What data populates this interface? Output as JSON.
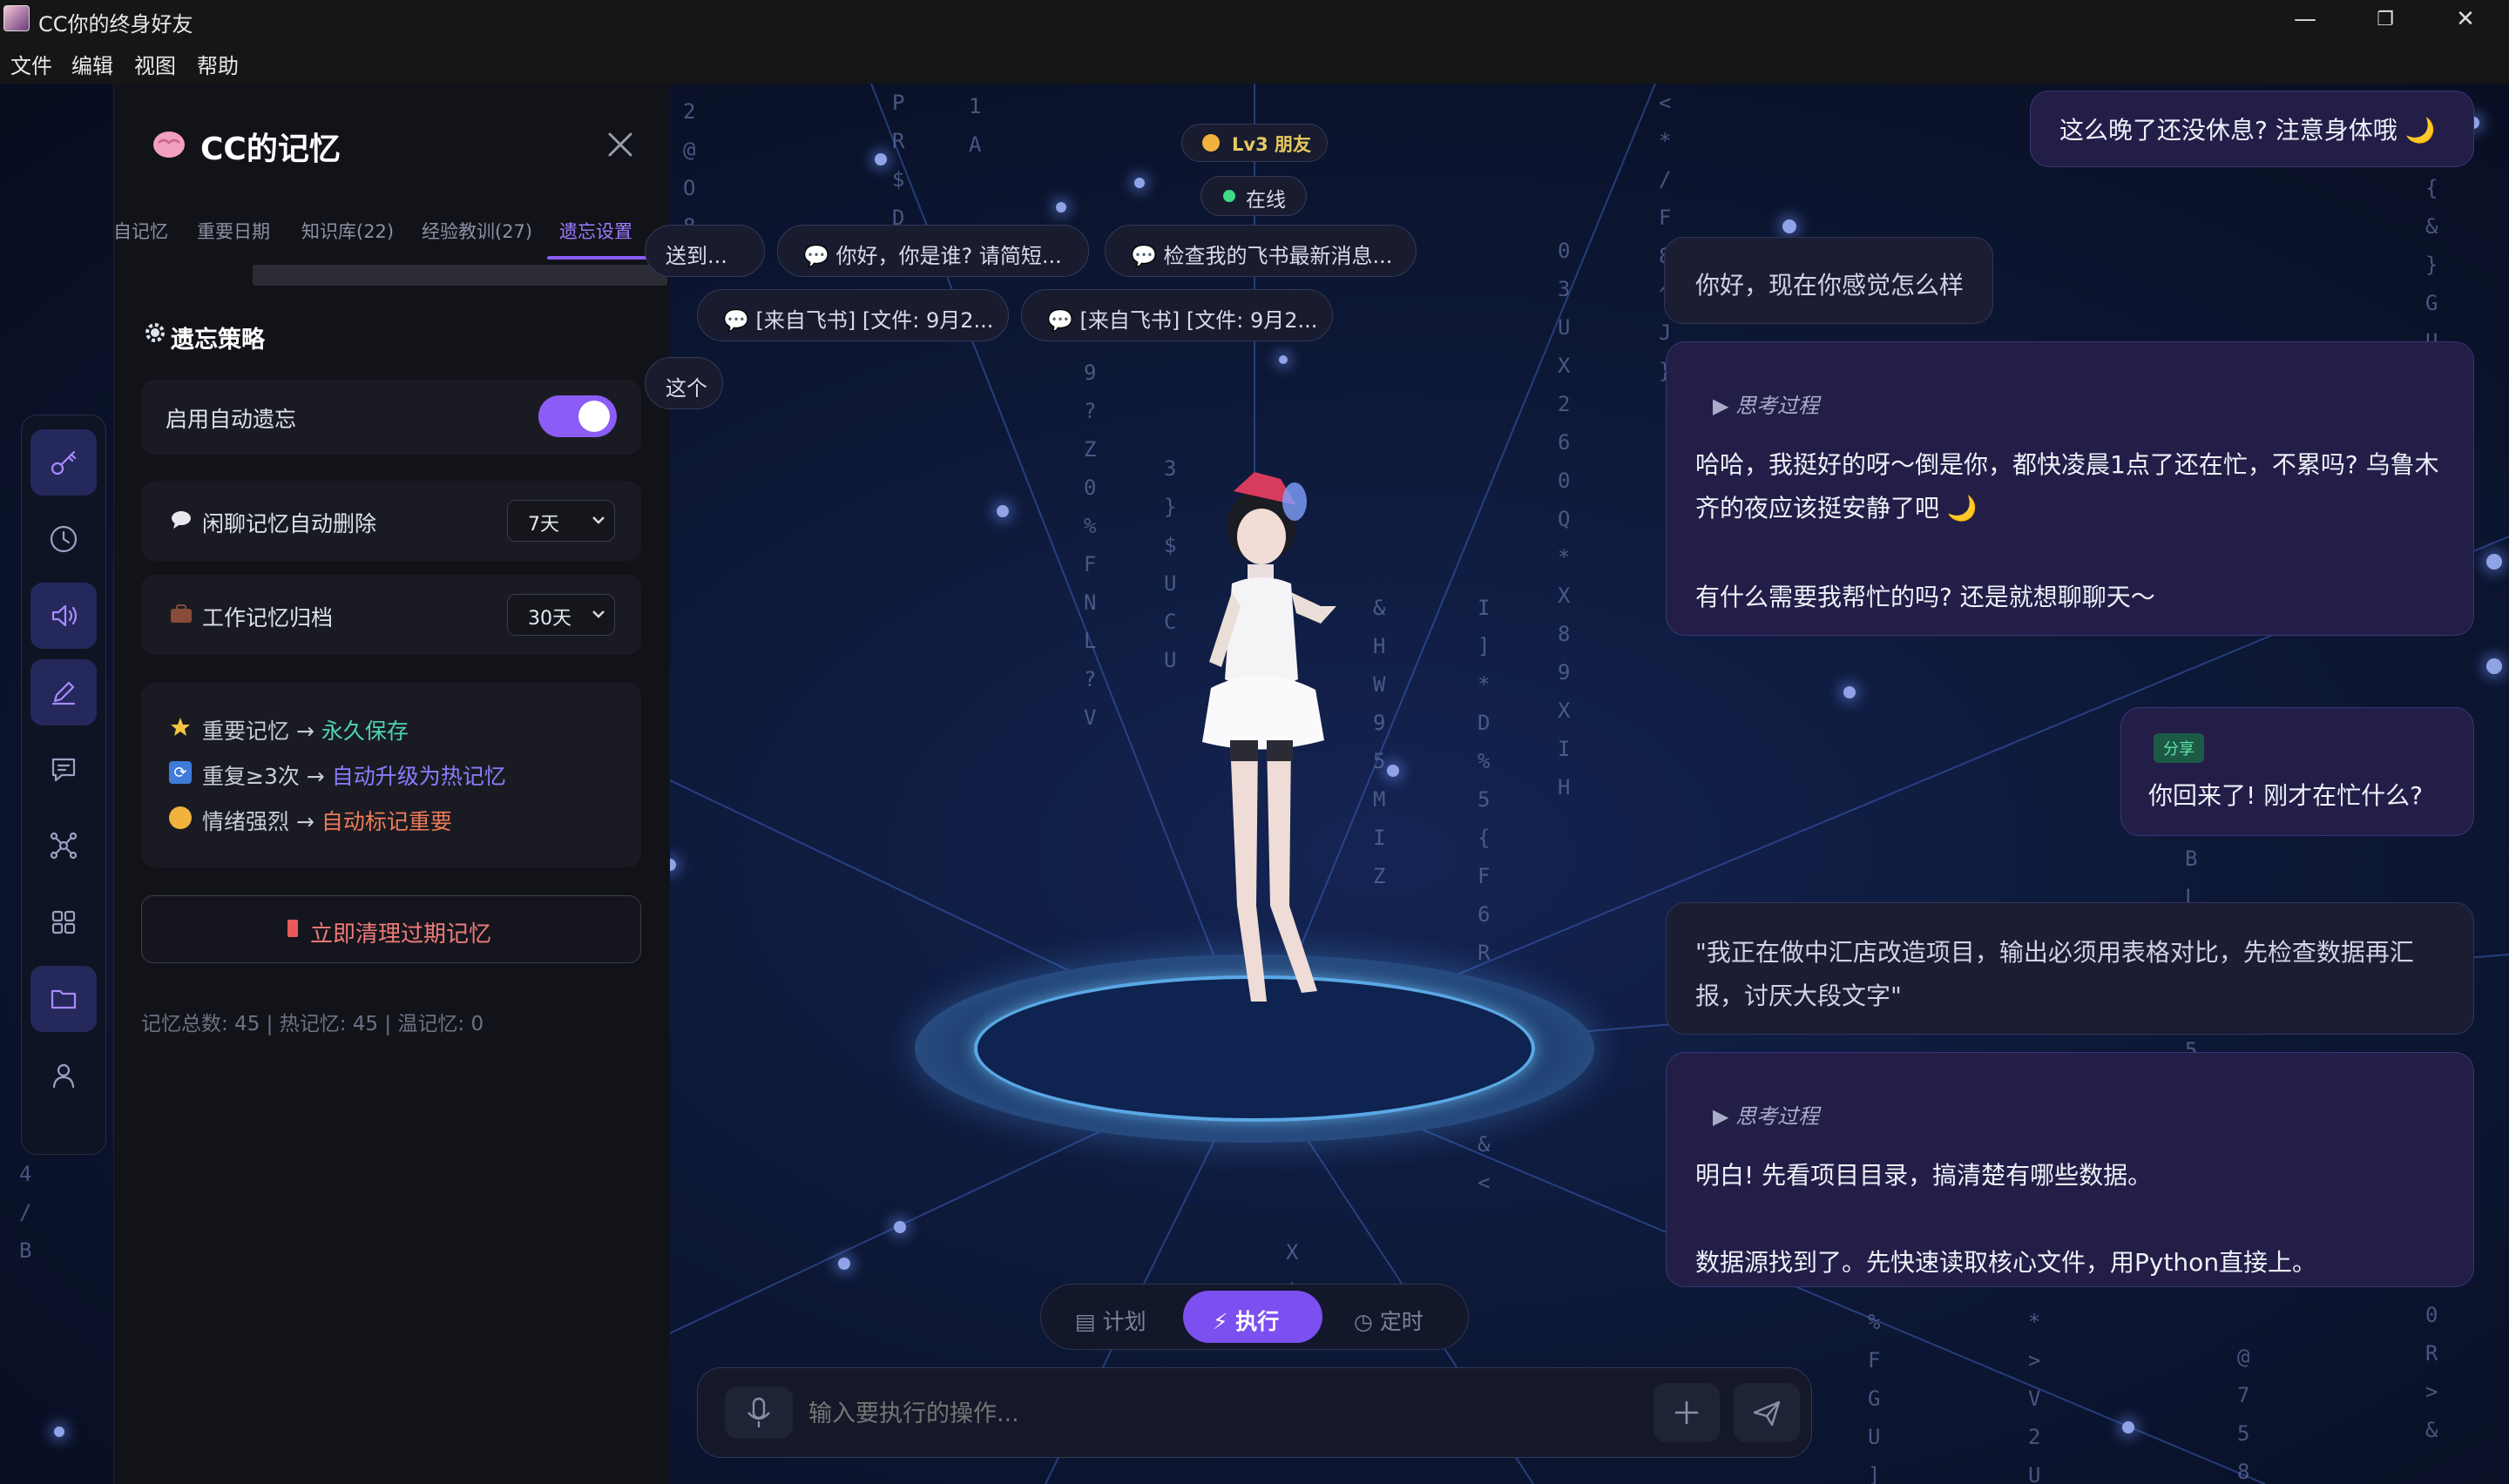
{
  "window": {
    "title": "CC你的终身好友"
  },
  "menu": [
    "文件",
    "编辑",
    "视图",
    "帮助"
  ],
  "memory_panel": {
    "title": "CC的记忆",
    "tabs": [
      "自记忆",
      "重要日期",
      "知识库(22)",
      "经验教训(27)",
      "遗忘设置"
    ],
    "active_tab": "遗忘设置",
    "section_title": "遗忘策略",
    "auto_forget": {
      "label": "启用自动遗忘",
      "enabled": true
    },
    "chat_delete": {
      "label": "闲聊记忆自动删除",
      "value": "7天"
    },
    "work_archive": {
      "label": "工作记忆归档",
      "value": "30天"
    },
    "rules": [
      {
        "prefix": "重要记忆 → ",
        "result": "永久保存",
        "color": "#4fd1b5"
      },
      {
        "prefix": "重复≥3次 → ",
        "result": "自动升级为热记忆",
        "color": "#8c7cff"
      },
      {
        "prefix": "情绪强烈 → ",
        "result": "自动标记重要",
        "color": "#f07a5a"
      }
    ],
    "clean_button": "立即清理过期记忆",
    "stats": "记忆总数: 45 | 热记忆: 45 | 温记忆: 0"
  },
  "status": {
    "level": "Lv3 朋友",
    "online": "在线"
  },
  "quick_chips": [
    "送到...",
    "你好，你是谁? 请简短...",
    "检查我的飞书最新消息...",
    "[来自飞书] [文件: 9月2...",
    "[来自飞书] [文件: 9月2...",
    "这个"
  ],
  "chat": {
    "m1": "这么晚了还没休息? 注意身体哦 🌙",
    "m2": "你好，现在你感觉怎么样",
    "think1": "思考过程",
    "m3_l1": "哈哈，我挺好的呀～倒是你，都快凌晨1点了还在忙，不累吗? 乌鲁木",
    "m3_l2": "齐的夜应该挺安静了吧 🌙",
    "m3_l3": "有什么需要我帮忙的吗? 还是就想聊聊天～",
    "share_tag": "分享",
    "m4": "你回来了! 刚才在忙什么?",
    "m5_l1": "\"我正在做中汇店改造项目，输出必须用表格对比，先检查数据再汇",
    "m5_l2": "报，讨厌大段文字\"",
    "think2": "思考过程",
    "m6_l1": "明白! 先看项目目录，搞清楚有哪些数据。",
    "m6_l2": "数据源找到了。先快速读取核心文件，用Python直接上。"
  },
  "modes": {
    "plan": "计划",
    "execute": "执行",
    "schedule": "定时",
    "active": "执行"
  },
  "input": {
    "placeholder": "输入要执行的操作..."
  },
  "icons": [
    "key-icon",
    "clock-icon",
    "speaker-icon",
    "pen-icon",
    "chat-icon",
    "network-icon",
    "grid-icon",
    "folder-icon",
    "user-icon"
  ]
}
